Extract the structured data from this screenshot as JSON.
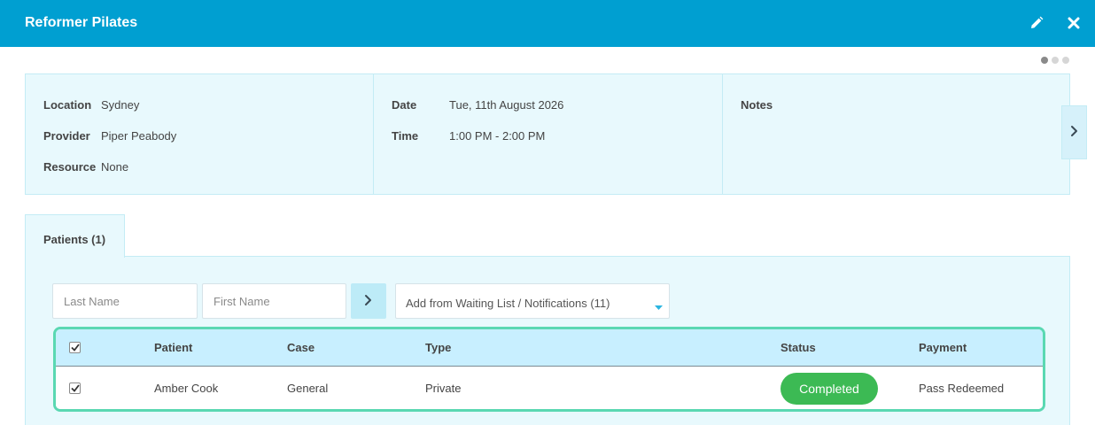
{
  "header": {
    "title": "Reformer Pilates",
    "edit_icon": "pencil-icon",
    "close_icon": "close-icon",
    "background": "#009fd1"
  },
  "pager": {
    "count": 3,
    "active": 1
  },
  "details": {
    "location_label": "Location",
    "location_value": "Sydney",
    "provider_label": "Provider",
    "provider_value": "Piper Peabody",
    "resource_label": "Resource",
    "resource_value": "None",
    "date_label": "Date",
    "date_value": "Tue, 11th August 2026",
    "time_label": "Time",
    "time_value": "1:00 PM - 2:00 PM",
    "notes_label": "Notes",
    "next_icon": "chevron-right-icon"
  },
  "tabs": [
    {
      "label": "Patients (1)"
    }
  ],
  "search": {
    "last_name_placeholder": "Last Name",
    "first_name_placeholder": "First Name",
    "go_icon": "chevron-right-icon",
    "waitlist_label": "Add from Waiting List / Notifications (11)",
    "waitlist_icon": "caret-down-icon"
  },
  "table": {
    "headers": {
      "patient": "Patient",
      "case": "Case",
      "type": "Type",
      "status": "Status",
      "payment": "Payment"
    },
    "header_checked": true,
    "rows": [
      {
        "checked": true,
        "patient": "Amber Cook",
        "case": "General",
        "type": "Private",
        "status": "Completed",
        "payment": "Pass Redeemed"
      }
    ],
    "status_color": "#3cba54",
    "highlight_color": "#5ad8b2"
  }
}
